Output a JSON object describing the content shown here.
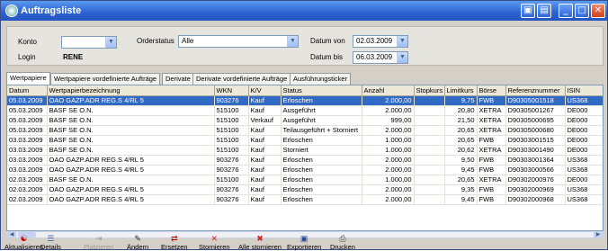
{
  "window": {
    "title": "Auftragsliste"
  },
  "filter": {
    "konto_label": "Konto",
    "konto_value": "",
    "login_label": "Login",
    "login_value": "RENE",
    "orderstatus_label": "Orderstatus",
    "orderstatus_value": "Alle",
    "datum_von_label": "Datum von",
    "datum_von_value": "02.03.2009",
    "datum_bis_label": "Datum bis",
    "datum_bis_value": "06.03.2009"
  },
  "tabs": [
    "Wertpapiere",
    "Wertpapiere vordefinierte Aufträge",
    "Derivate",
    "Derivate vordefinierte Aufträge",
    "Ausführungsticker"
  ],
  "table": {
    "headers": [
      "Datum",
      "Wertpapierbezeichnung",
      "WKN",
      "K/V",
      "Status",
      "Anzahl",
      "Stopkurs",
      "Limitkurs",
      "Börse",
      "Referenznummer",
      "ISIN"
    ],
    "rows": [
      [
        "05.03.2009",
        "OAO GAZP.ADR REG.S 4/RL 5",
        "903276",
        "Kauf",
        "Erloschen",
        "2.000,00",
        "",
        "9,75",
        "FWB",
        "D90305001518",
        "US368"
      ],
      [
        "05.03.2009",
        "BASF SE O.N.",
        "515100",
        "Kauf",
        "Ausgeführt",
        "2.000,00",
        "",
        "20,80",
        "XETRA",
        "D90305001267",
        "DE000"
      ],
      [
        "05.03.2009",
        "BASF SE O.N.",
        "515100",
        "Verkauf",
        "Ausgeführt",
        "999,00",
        "",
        "21,50",
        "XETRA",
        "D90305000695",
        "DE000"
      ],
      [
        "05.03.2009",
        "BASF SE O.N.",
        "515100",
        "Kauf",
        "Teilausgeführt + Storniert",
        "2.000,00",
        "",
        "20,65",
        "XETRA",
        "D90305000680",
        "DE000"
      ],
      [
        "03.03.2009",
        "BASF SE O.N.",
        "515100",
        "Kauf",
        "Erloschen",
        "1.000,00",
        "",
        "20,65",
        "FWB",
        "D90303001515",
        "DE000"
      ],
      [
        "03.03.2009",
        "BASF SE O.N.",
        "515100",
        "Kauf",
        "Storniert",
        "1.000,00",
        "",
        "20,62",
        "XETRA",
        "D90303001490",
        "DE000"
      ],
      [
        "03.03.2009",
        "OAO GAZP.ADR REG.S 4/RL 5",
        "903276",
        "Kauf",
        "Erloschen",
        "2.000,00",
        "",
        "9,50",
        "FWB",
        "D90303001364",
        "US368"
      ],
      [
        "03.03.2009",
        "OAO GAZP.ADR REG.S 4/RL 5",
        "903276",
        "Kauf",
        "Erloschen",
        "2.000,00",
        "",
        "9,45",
        "FWB",
        "D90303000566",
        "US368"
      ],
      [
        "02.03.2009",
        "BASF SE O.N.",
        "515100",
        "Kauf",
        "Erloschen",
        "1.000,00",
        "",
        "20,65",
        "XETRA",
        "D90302000976",
        "DE000"
      ],
      [
        "02.03.2009",
        "OAO GAZP.ADR REG.S 4/RL 5",
        "903276",
        "Kauf",
        "Erloschen",
        "2.000,00",
        "",
        "9,35",
        "FWB",
        "D90302000969",
        "US368"
      ],
      [
        "02.03.2009",
        "OAO GAZP.ADR REG.S 4/RL 5",
        "903276",
        "Kauf",
        "Erloschen",
        "2.000,00",
        "",
        "9,45",
        "FWB",
        "D90302000968",
        "US368"
      ]
    ]
  },
  "toolbar": [
    {
      "label": "Aktualisieren",
      "icon": "refresh-icon",
      "color": "#c00000",
      "enabled": true
    },
    {
      "label": "Details",
      "icon": "details-icon",
      "color": "#4060a0",
      "enabled": true
    },
    {
      "label": "Platzieren",
      "icon": "place-icon",
      "color": "#9a9890",
      "enabled": false
    },
    {
      "label": "Ändern",
      "icon": "pencil-icon",
      "color": "#222222",
      "enabled": true
    },
    {
      "label": "Ersetzen",
      "icon": "replace-icon",
      "color": "#c00000",
      "enabled": true
    },
    {
      "label": "Stornieren",
      "icon": "cancel-x-icon",
      "color": "#d02020",
      "enabled": true
    },
    {
      "label": "Alle stornieren",
      "icon": "cancel-all-icon",
      "color": "#d02020",
      "enabled": true
    },
    {
      "label": "Exportieren",
      "icon": "floppy-disk-icon",
      "color": "#2a4a9a",
      "enabled": true
    },
    {
      "label": "Drucken",
      "icon": "printer-icon",
      "color": "#444444",
      "enabled": true
    }
  ],
  "colors": {
    "titlebar": "#2a62d0",
    "selection": "#316ac5"
  }
}
